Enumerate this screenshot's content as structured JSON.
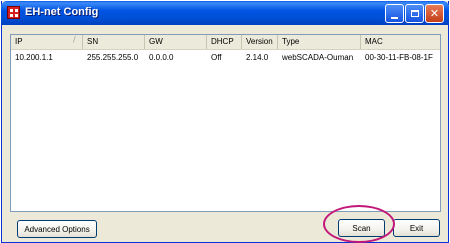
{
  "window": {
    "title": "EH-net Config"
  },
  "list": {
    "columns": [
      "IP",
      "SN",
      "GW",
      "DHCP",
      "Version",
      "Type",
      "MAC"
    ],
    "rows": [
      [
        "10.200.1.1",
        "255.255.255.0",
        "0.0.0.0",
        "Off",
        "2.14.0",
        "webSCADA-Ouman",
        "00-30-11-FB-08-1F"
      ]
    ]
  },
  "buttons": {
    "advanced": "Advanced Options",
    "scan": "Scan",
    "exit": "Exit"
  },
  "icons": {
    "app": "app-grid-icon",
    "minimize": "minimize-icon",
    "maximize": "maximize-icon",
    "close": "close-icon",
    "sort": "sort-indicator-icon"
  },
  "colors": {
    "highlight": "#c2187a",
    "titlebar": "#0054e3"
  }
}
